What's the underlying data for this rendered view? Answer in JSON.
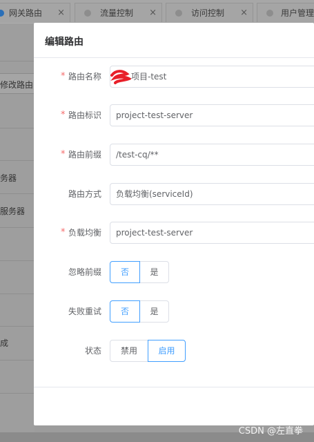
{
  "tabs": [
    {
      "label": "网关路由",
      "active": true
    },
    {
      "label": "流量控制",
      "active": false
    },
    {
      "label": "访问控制",
      "active": false
    },
    {
      "label": "用户管理",
      "active": false
    }
  ],
  "background": {
    "texts": [
      "修改路由,如",
      "务器",
      "服务器",
      "成"
    ]
  },
  "dialog": {
    "title": "编辑路由",
    "fields": {
      "name": {
        "label": "路由名称",
        "required": true,
        "value": "项目-test"
      },
      "id": {
        "label": "路由标识",
        "required": true,
        "value": "project-test-server"
      },
      "prefix": {
        "label": "路由前缀",
        "required": true,
        "value": "/test-cq/**"
      },
      "mode": {
        "label": "路由方式",
        "required": false,
        "value": "负载均衡(serviceId)"
      },
      "lb": {
        "label": "负载均衡",
        "required": true,
        "value": "project-test-server"
      }
    },
    "strip_prefix": {
      "label": "忽略前缀",
      "options": [
        "否",
        "是"
      ],
      "selected": "否"
    },
    "retry": {
      "label": "失败重试",
      "options": [
        "否",
        "是"
      ],
      "selected": "否"
    },
    "status": {
      "label": "状态",
      "options": [
        "禁用",
        "启用"
      ],
      "selected": "启用"
    },
    "required_mark": "*"
  },
  "watermark": "CSDN @左直拳",
  "colors": {
    "accent": "#409eff",
    "required": "#f56c6c",
    "active_tab_dot": "#2a6fb8"
  }
}
